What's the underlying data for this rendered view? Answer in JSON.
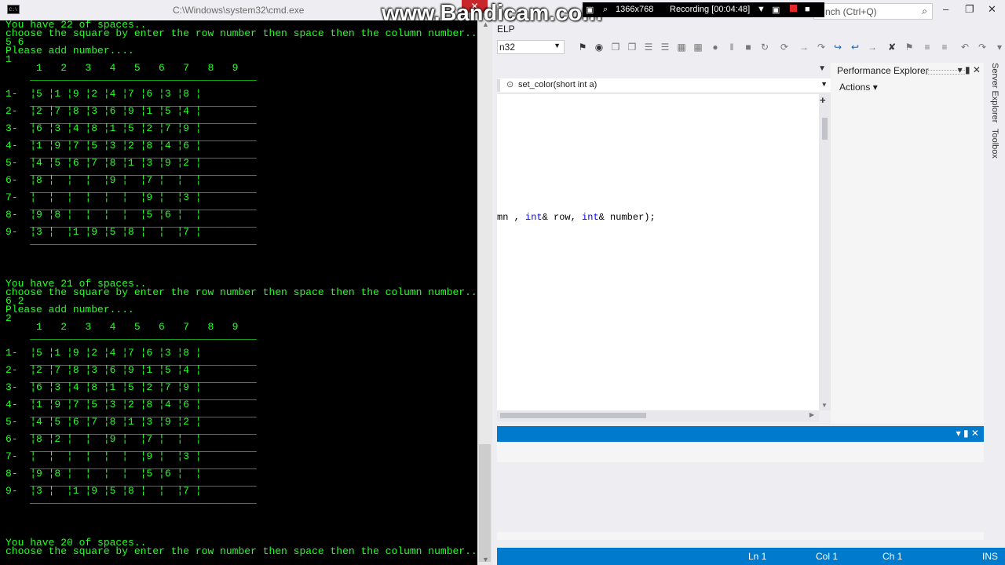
{
  "visual_studio": {
    "quick_launch_placeholder": "nch (Ctrl+Q)",
    "menu_fragment": "ELP",
    "platform_combo": "n32",
    "nav_member": "set_color(short int a)",
    "code_line": {
      "pre": "mn , ",
      "kw1": "int",
      "mid1": "& row, ",
      "kw2": "int",
      "mid2": "& number);"
    },
    "perf_explorer_title": "Performance Explorer",
    "actions_label": "Actions",
    "right_tabs": [
      "Server Explorer",
      "Toolbox"
    ],
    "status": {
      "ln": "Ln 1",
      "col": "Col 1",
      "ch": "Ch 1",
      "ins": "INS"
    }
  },
  "bandicam": {
    "watermark": "www.Bandicam.com",
    "resolution": "1366x768",
    "recording": "Recording [00:04:48]"
  },
  "cmd": {
    "title": "C:\\Windows\\system32\\cmd.exe",
    "icon_text": "C:\\",
    "lines": [
      "You have 22 of spaces..",
      "choose the square by enter the row number then space then the column number...",
      "5 6",
      "Please add number....",
      "1",
      "     1   2   3   4   5   6   7   8   9",
      "    _____________________________________",
      "",
      "1-  ¦5 ¦1 ¦9 ¦2 ¦4 ¦7 ¦6 ¦3 ¦8 ¦",
      "    _____________________________________",
      "2-  ¦2 ¦7 ¦8 ¦3 ¦6 ¦9 ¦1 ¦5 ¦4 ¦",
      "    _____________________________________",
      "3-  ¦6 ¦3 ¦4 ¦8 ¦1 ¦5 ¦2 ¦7 ¦9 ¦",
      "    _____________________________________",
      "4-  ¦1 ¦9 ¦7 ¦5 ¦3 ¦2 ¦8 ¦4 ¦6 ¦",
      "    _____________________________________",
      "5-  ¦4 ¦5 ¦6 ¦7 ¦8 ¦1 ¦3 ¦9 ¦2 ¦",
      "    _____________________________________",
      "6-  ¦8 ¦  ¦  ¦  ¦9 ¦  ¦7 ¦  ¦  ¦",
      "    _____________________________________",
      "7-  ¦  ¦  ¦  ¦  ¦  ¦  ¦9 ¦  ¦3 ¦",
      "    _____________________________________",
      "8-  ¦9 ¦8 ¦  ¦  ¦  ¦  ¦5 ¦6 ¦  ¦",
      "    _____________________________________",
      "9-  ¦3 ¦  ¦1 ¦9 ¦5 ¦8 ¦  ¦  ¦7 ¦",
      "    _____________________________________",
      "",
      "",
      "",
      "",
      "You have 21 of spaces..",
      "choose the square by enter the row number then space then the column number...",
      "6 2",
      "Please add number....",
      "2",
      "     1   2   3   4   5   6   7   8   9",
      "    _____________________________________",
      "",
      "1-  ¦5 ¦1 ¦9 ¦2 ¦4 ¦7 ¦6 ¦3 ¦8 ¦",
      "    _____________________________________",
      "2-  ¦2 ¦7 ¦8 ¦3 ¦6 ¦9 ¦1 ¦5 ¦4 ¦",
      "    _____________________________________",
      "3-  ¦6 ¦3 ¦4 ¦8 ¦1 ¦5 ¦2 ¦7 ¦9 ¦",
      "    _____________________________________",
      "4-  ¦1 ¦9 ¦7 ¦5 ¦3 ¦2 ¦8 ¦4 ¦6 ¦",
      "    _____________________________________",
      "5-  ¦4 ¦5 ¦6 ¦7 ¦8 ¦1 ¦3 ¦9 ¦2 ¦",
      "    _____________________________________",
      "6-  ¦8 ¦2 ¦  ¦  ¦9 ¦  ¦7 ¦  ¦  ¦",
      "    _____________________________________",
      "7-  ¦  ¦  ¦  ¦  ¦  ¦  ¦9 ¦  ¦3 ¦",
      "    _____________________________________",
      "8-  ¦9 ¦8 ¦  ¦  ¦  ¦  ¦5 ¦6 ¦  ¦",
      "    _____________________________________",
      "9-  ¦3 ¦  ¦1 ¦9 ¦5 ¦8 ¦  ¦  ¦7 ¦",
      "    _____________________________________",
      "",
      "",
      "",
      "",
      "You have 20 of spaces..",
      "choose the square by enter the row number then space then the column number..."
    ]
  },
  "colors": {
    "console_text": "#23ff23",
    "console_bg": "#000000",
    "vs_accent": "#007acc",
    "close_red": "#c7272b"
  }
}
